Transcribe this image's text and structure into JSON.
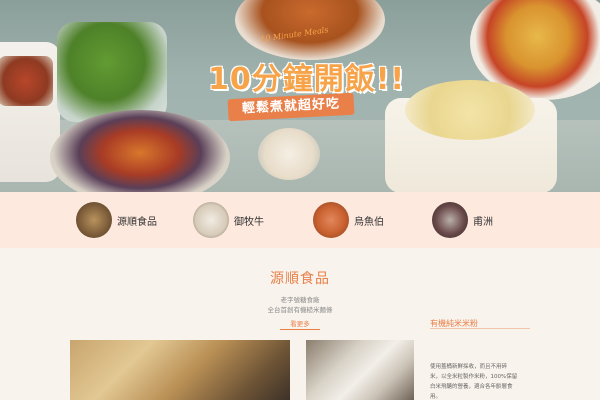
{
  "hero": {
    "promo_subtitle": "10 Minute Meals",
    "promo_title": "10分鐘開飯!!",
    "promo_tagline": "輕鬆煮就超好吃"
  },
  "categories": [
    {
      "label": "源順食品",
      "icon": "noodle-thumb"
    },
    {
      "label": "御牧牛",
      "icon": "dumpling-thumb"
    },
    {
      "label": "烏魚伯",
      "icon": "roe-thumb"
    },
    {
      "label": "甫洲",
      "icon": "grain-thumb"
    }
  ],
  "section": {
    "title": "源順食品",
    "desc_line1": "老字號糖食廠",
    "desc_line2": "全台首創有機糙米麵條",
    "more_link": "看更多"
  },
  "product": {
    "title": "有機純米米粉",
    "desc_lines": [
      "使用蓋桶新鮮採收，而且不用碎",
      "米，以全米粒製作米粉，100%保留",
      "白米飛醣的營養，適合各年齡層食",
      "用。"
    ]
  },
  "colors": {
    "accent": "#e9804a",
    "category_bar": "#fde9de",
    "page_bg": "#f8f3ec"
  }
}
